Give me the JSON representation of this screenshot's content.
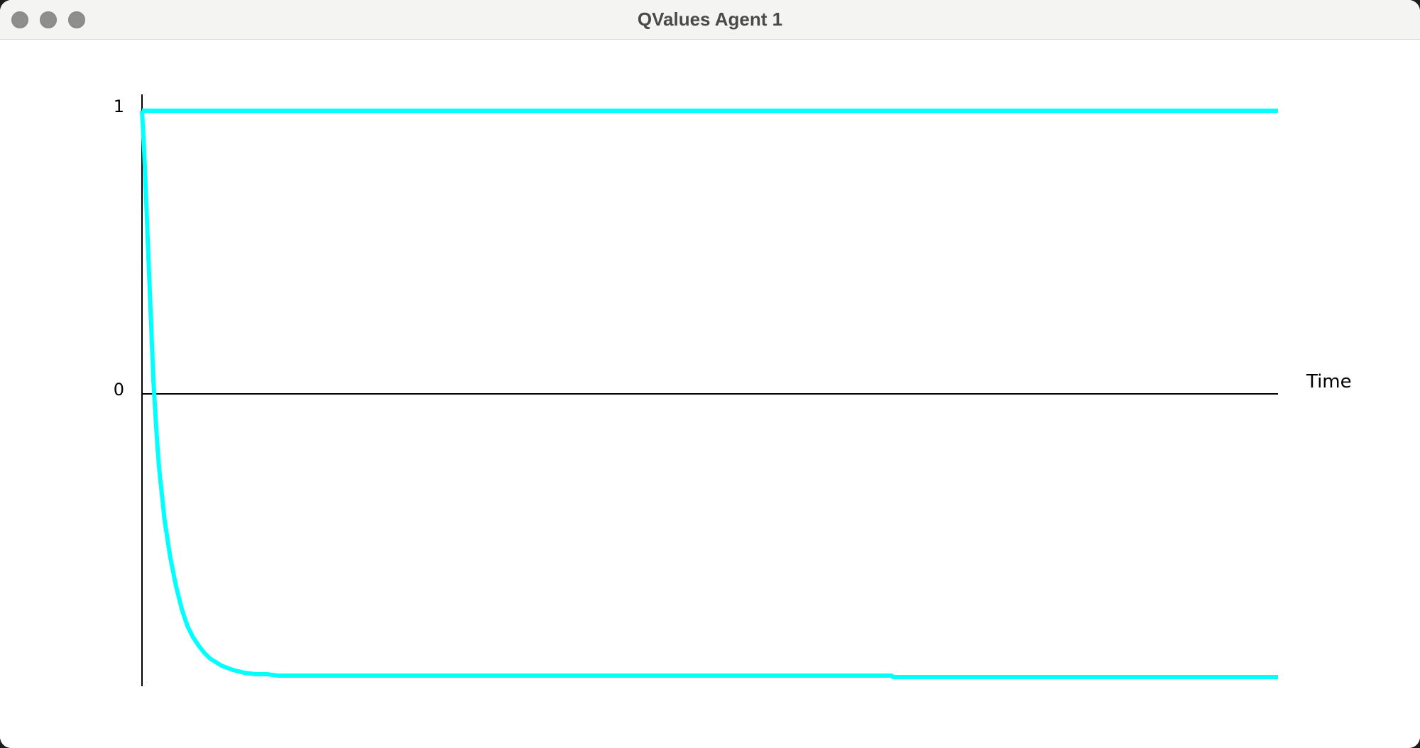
{
  "window": {
    "title": "QValues Agent 1",
    "controls": [
      "close",
      "minimize",
      "zoom"
    ]
  },
  "chart_data": {
    "type": "line",
    "title": "",
    "xlabel": "Time",
    "ylabel": "",
    "y_ticks": [
      "1",
      "0"
    ],
    "ylim": [
      -1,
      1
    ],
    "xlim": [
      0,
      1000
    ],
    "grid": false,
    "legend": "none",
    "series_color": "#00ffff",
    "axis_color": "#000000",
    "series": [
      {
        "x": [
          0,
          1000
        ],
        "y": [
          1,
          1
        ]
      },
      {
        "x": [
          0,
          2,
          5,
          8,
          10,
          13,
          15,
          20,
          25,
          30,
          35,
          40,
          45,
          50,
          55,
          60,
          70,
          80,
          90,
          100,
          110,
          120,
          130,
          150,
          200,
          300,
          500,
          660,
          661,
          800,
          1000
        ],
        "y": [
          1,
          0.85,
          0.55,
          0.25,
          0.05,
          -0.15,
          -0.26,
          -0.45,
          -0.58,
          -0.68,
          -0.76,
          -0.82,
          -0.86,
          -0.89,
          -0.915,
          -0.935,
          -0.96,
          -0.975,
          -0.985,
          -0.99,
          -0.99,
          -0.995,
          -0.995,
          -0.995,
          -0.995,
          -0.995,
          -0.995,
          -0.995,
          -1.0,
          -1.0,
          -1.0
        ]
      }
    ]
  }
}
